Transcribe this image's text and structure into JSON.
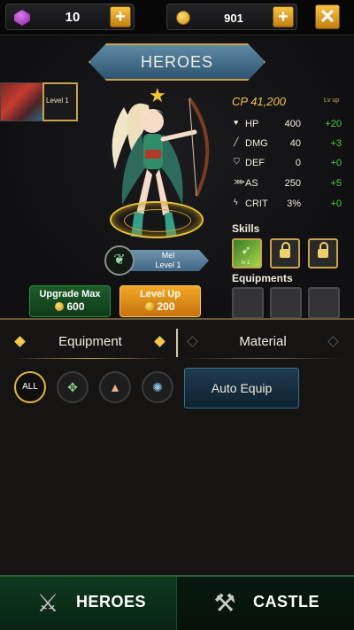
{
  "topbar": {
    "gems": "10",
    "gold": "901",
    "plus_glyph": "+",
    "close_glyph": "✕"
  },
  "hero_panel": {
    "title": "HEROES",
    "thumb_level": "Level 1",
    "hero_name": "Mel",
    "hero_level": "Level 1",
    "upgrade_max_label": "Upgrade Max",
    "upgrade_max_cost": "600",
    "level_up_label": "Level Up",
    "level_up_cost": "200"
  },
  "stats": {
    "cp": "CP 41,200",
    "lv_up": "Lv up",
    "rows": [
      {
        "icon": "heart-icon",
        "name": "HP",
        "value": "400",
        "bonus": "+20"
      },
      {
        "icon": "sword-icon",
        "name": "DMG",
        "value": "40",
        "bonus": "+3"
      },
      {
        "icon": "shield-icon",
        "name": "DEF",
        "value": "0",
        "bonus": "+0"
      },
      {
        "icon": "claw-icon",
        "name": "AS",
        "value": "250",
        "bonus": "+5"
      },
      {
        "icon": "lightning-icon",
        "name": "CRIT",
        "value": "3%",
        "bonus": "+0"
      }
    ],
    "skills_label": "Skills",
    "skill_level": "lv 1",
    "equipments_label": "Equipments"
  },
  "lower": {
    "tab_equipment": "Equipment",
    "tab_material": "Material",
    "filter_all": "ALL",
    "auto_equip": "Auto Equip"
  },
  "nav": {
    "heroes": "HEROES",
    "castle": "CASTLE"
  },
  "colors": {
    "gold_accent": "#c9a24a",
    "bonus_green": "#4fcf3f",
    "cp_gold": "#f0c44c"
  }
}
